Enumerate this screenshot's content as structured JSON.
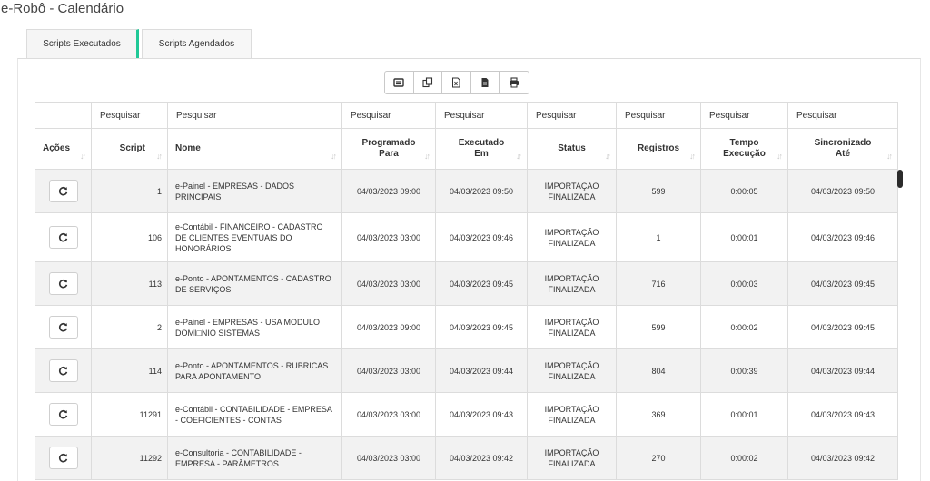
{
  "page": {
    "title": "e-Robô - Calendário"
  },
  "tabs": [
    {
      "label": "Scripts Executados",
      "active": true
    },
    {
      "label": "Scripts Agendados",
      "active": false
    }
  ],
  "toolbar": {
    "buttons": [
      {
        "icon": "columns-icon"
      },
      {
        "icon": "copy-icon"
      },
      {
        "icon": "excel-icon"
      },
      {
        "icon": "file-icon"
      },
      {
        "icon": "print-icon"
      }
    ]
  },
  "search": {
    "placeholders": [
      "Pesquisar",
      "Pesquisar",
      "Pesquisar",
      "Pesquisar",
      "Pesquisar",
      "Pesquisar",
      "Pesquisar",
      "Pesquisar"
    ]
  },
  "table": {
    "headers": {
      "acoes": "Ações",
      "script": "Script",
      "nome": "Nome",
      "programado": [
        "Programado",
        "Para"
      ],
      "executado": [
        "Executado",
        "Em"
      ],
      "status": "Status",
      "registros": "Registros",
      "tempo": [
        "Tempo",
        "Execução"
      ],
      "sincronizado": [
        "Sincronizado",
        "Até"
      ]
    },
    "rows": [
      {
        "script": "1",
        "nome": "e-Painel - EMPRESAS - DADOS PRINCIPAIS",
        "programado": "04/03/2023 09:00",
        "executado": "04/03/2023 09:50",
        "status": "IMPORTAÇÃO FINALIZADA",
        "registros": "599",
        "tempo": "0:00:05",
        "sincronizado": "04/03/2023 09:50"
      },
      {
        "script": "106",
        "nome": "e-Contábil - FINANCEIRO - CADASTRO DE CLIENTES EVENTUAIS DO HONORÁRIOS",
        "programado": "04/03/2023 03:00",
        "executado": "04/03/2023 09:46",
        "status": "IMPORTAÇÃO FINALIZADA",
        "registros": "1",
        "tempo": "0:00:01",
        "sincronizado": "04/03/2023 09:46"
      },
      {
        "script": "113",
        "nome": "e-Ponto - APONTAMENTOS - CADASTRO DE SERVIÇOS",
        "programado": "04/03/2023 03:00",
        "executado": "04/03/2023 09:45",
        "status": "IMPORTAÇÃO FINALIZADA",
        "registros": "716",
        "tempo": "0:00:03",
        "sincronizado": "04/03/2023 09:45"
      },
      {
        "script": "2",
        "nome": "e-Painel - EMPRESAS - USA MODULO DOMÍ□NIO SISTEMAS",
        "programado": "04/03/2023 09:00",
        "executado": "04/03/2023 09:45",
        "status": "IMPORTAÇÃO FINALIZADA",
        "registros": "599",
        "tempo": "0:00:02",
        "sincronizado": "04/03/2023 09:45"
      },
      {
        "script": "114",
        "nome": "e-Ponto - APONTAMENTOS - RUBRICAS PARA APONTAMENTO",
        "programado": "04/03/2023 03:00",
        "executado": "04/03/2023 09:44",
        "status": "IMPORTAÇÃO FINALIZADA",
        "registros": "804",
        "tempo": "0:00:39",
        "sincronizado": "04/03/2023 09:44"
      },
      {
        "script": "11291",
        "nome": "e-Contábil - CONTABILIDADE - EMPRESA - COEFICIENTES - CONTAS",
        "programado": "04/03/2023 03:00",
        "executado": "04/03/2023 09:43",
        "status": "IMPORTAÇÃO FINALIZADA",
        "registros": "369",
        "tempo": "0:00:01",
        "sincronizado": "04/03/2023 09:43"
      },
      {
        "script": "11292",
        "nome": "e-Consultoria - CONTABILIDADE - EMPRESA - PARÂMETROS",
        "programado": "04/03/2023 03:00",
        "executado": "04/03/2023 09:42",
        "status": "IMPORTAÇÃO FINALIZADA",
        "registros": "270",
        "tempo": "0:00:02",
        "sincronizado": "04/03/2023 09:42"
      }
    ]
  },
  "colors": {
    "tab_accent": "#20c997",
    "row_stripe": "#f2f2f2",
    "border": "#dcdcdc"
  }
}
